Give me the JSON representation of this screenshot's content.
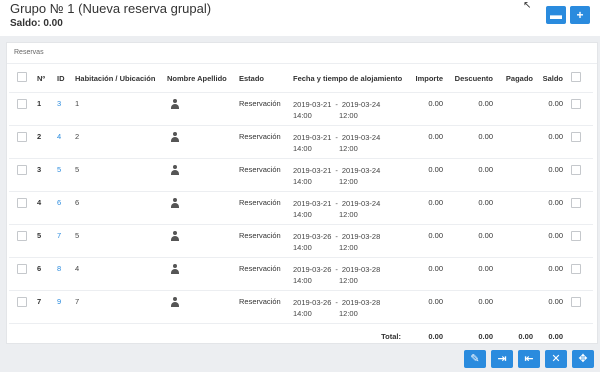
{
  "header": {
    "title": "Grupo № 1 (Nueva reserva grupal)",
    "saldo_label": "Saldo: 0.00",
    "top_buttons": [
      {
        "icon": "chat-icon",
        "glyph": "▬"
      },
      {
        "icon": "plus-icon",
        "glyph": "+"
      }
    ]
  },
  "panel": {
    "title": "Reservas",
    "columns": {
      "num": "Nº",
      "id": "ID",
      "room": "Habitación / Ubicación",
      "name": "Nombre Apellido",
      "status": "Estado",
      "dates": "Fecha y tiempo de alojamiento",
      "importe": "Importe",
      "descuento": "Descuento",
      "pagado": "Pagado",
      "saldo": "Saldo"
    },
    "rows": [
      {
        "num": "1",
        "id": "3",
        "room": "1",
        "status": "Reservación",
        "start_date": "2019-03-21",
        "start_time": "14:00",
        "end_date": "2019-03-24",
        "end_time": "12:00",
        "importe": "0.00",
        "descuento": "0.00",
        "pagado": "",
        "saldo": "0.00"
      },
      {
        "num": "2",
        "id": "4",
        "room": "2",
        "status": "Reservación",
        "start_date": "2019-03-21",
        "start_time": "14:00",
        "end_date": "2019-03-24",
        "end_time": "12:00",
        "importe": "0.00",
        "descuento": "0.00",
        "pagado": "",
        "saldo": "0.00"
      },
      {
        "num": "3",
        "id": "5",
        "room": "5",
        "status": "Reservación",
        "start_date": "2019-03-21",
        "start_time": "14:00",
        "end_date": "2019-03-24",
        "end_time": "12:00",
        "importe": "0.00",
        "descuento": "0.00",
        "pagado": "",
        "saldo": "0.00"
      },
      {
        "num": "4",
        "id": "6",
        "room": "6",
        "status": "Reservación",
        "start_date": "2019-03-21",
        "start_time": "14:00",
        "end_date": "2019-03-24",
        "end_time": "12:00",
        "importe": "0.00",
        "descuento": "0.00",
        "pagado": "",
        "saldo": "0.00"
      },
      {
        "num": "5",
        "id": "7",
        "room": "5",
        "status": "Reservación",
        "start_date": "2019-03-26",
        "start_time": "14:00",
        "end_date": "2019-03-28",
        "end_time": "12:00",
        "importe": "0.00",
        "descuento": "0.00",
        "pagado": "",
        "saldo": "0.00"
      },
      {
        "num": "6",
        "id": "8",
        "room": "4",
        "status": "Reservación",
        "start_date": "2019-03-26",
        "start_time": "14:00",
        "end_date": "2019-03-28",
        "end_time": "12:00",
        "importe": "0.00",
        "descuento": "0.00",
        "pagado": "",
        "saldo": "0.00"
      },
      {
        "num": "7",
        "id": "9",
        "room": "7",
        "status": "Reservación",
        "start_date": "2019-03-26",
        "start_time": "14:00",
        "end_date": "2019-03-28",
        "end_time": "12:00",
        "importe": "0.00",
        "descuento": "0.00",
        "pagado": "",
        "saldo": "0.00"
      }
    ],
    "totals": {
      "label": "Total:",
      "importe": "0.00",
      "descuento": "0.00",
      "pagado": "0.00",
      "saldo": "0.00"
    }
  },
  "bottom_buttons": [
    {
      "icon": "edit-icon",
      "glyph": "✎"
    },
    {
      "icon": "check-in-icon",
      "glyph": "⇥"
    },
    {
      "icon": "check-out-icon",
      "glyph": "⇤"
    },
    {
      "icon": "cancel-icon",
      "glyph": "✕"
    },
    {
      "icon": "move-icon",
      "glyph": "✥"
    }
  ],
  "date_separator": "-",
  "cursor_glyph": "↖"
}
